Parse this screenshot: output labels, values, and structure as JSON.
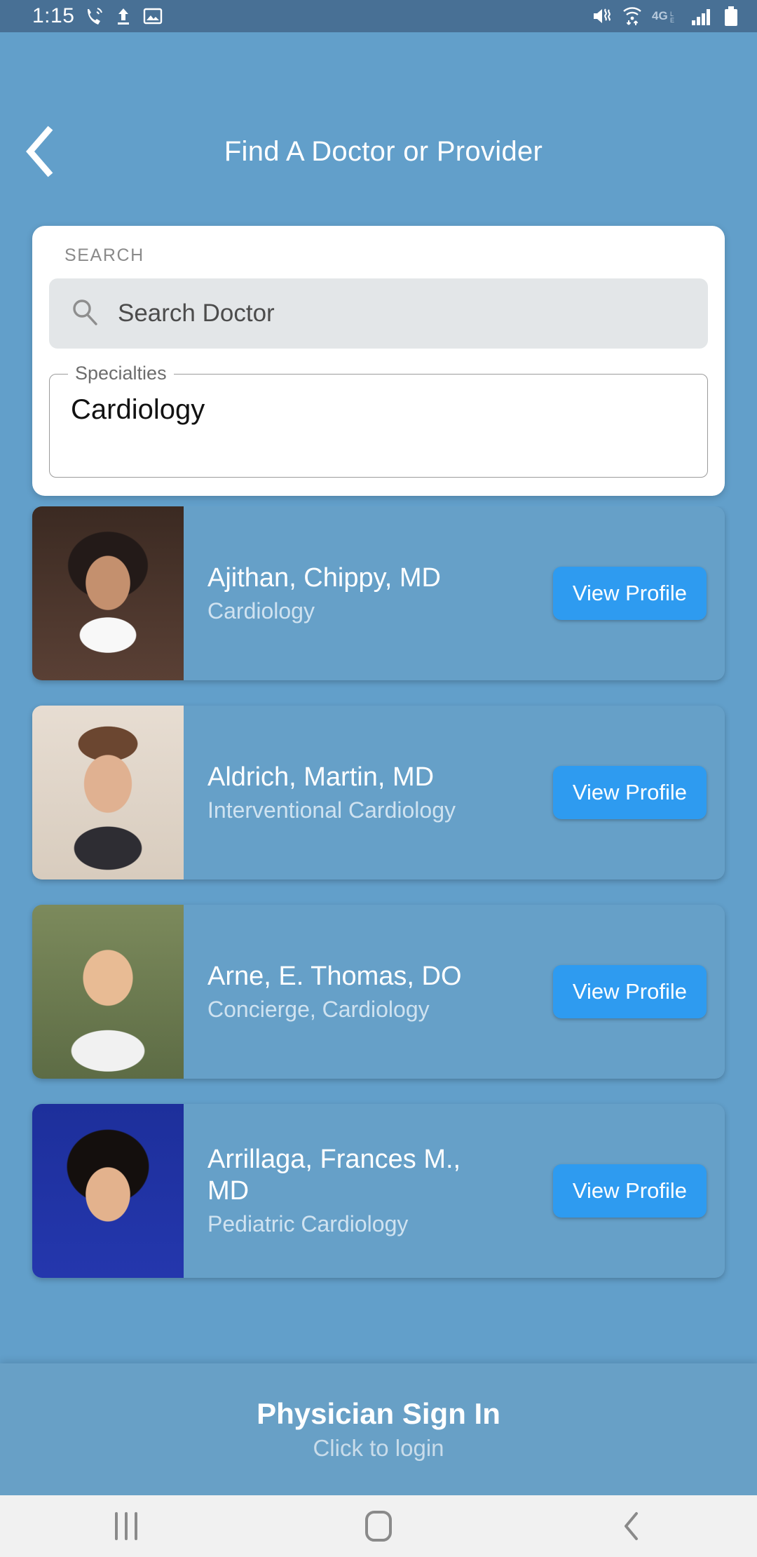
{
  "status_bar": {
    "time": "1:15",
    "left_icons": [
      "call-icon",
      "upload-icon",
      "image-icon"
    ],
    "right_icons": [
      "mute-vibrate-icon",
      "wifi-transfer-icon",
      "4g-lte-icon",
      "signal-bars-icon",
      "battery-icon"
    ],
    "network_label": "4G",
    "background_color": "#487095"
  },
  "header": {
    "back_label": "‹",
    "title": "Find A Doctor or Provider",
    "background_color": "#629fca"
  },
  "search": {
    "section_label": "SEARCH",
    "input_placeholder": "Search Doctor",
    "input_value": "",
    "specialties_label": "Specialties",
    "specialties_value": "Cardiology"
  },
  "doctors": [
    {
      "name": "Ajithan, Chippy, MD",
      "specialty": "Cardiology",
      "button_label": "View Profile",
      "photo": "doctor-portrait"
    },
    {
      "name": "Aldrich, Martin, MD",
      "specialty": "Interventional Cardiology",
      "button_label": "View Profile",
      "photo": "doctor-portrait"
    },
    {
      "name": "Arne, E. Thomas, DO",
      "specialty": "Concierge, Cardiology",
      "button_label": "View Profile",
      "photo": "doctor-portrait"
    },
    {
      "name": "Arrillaga, Frances M., MD",
      "specialty": "Pediatric Cardiology",
      "button_label": "View Profile",
      "photo": "doctor-portrait"
    }
  ],
  "sign_in": {
    "title": "Physician Sign In",
    "subtitle": "Click to login"
  },
  "nav_bar": {
    "recents_label": "recents-icon",
    "home_label": "home-icon",
    "back_label": "‹"
  },
  "colors": {
    "app_background": "#629fca",
    "card_background": "#66a0c8",
    "accent_button": "#2e9bf0",
    "status_bar": "#487095",
    "search_field": "#e3e6e8"
  }
}
